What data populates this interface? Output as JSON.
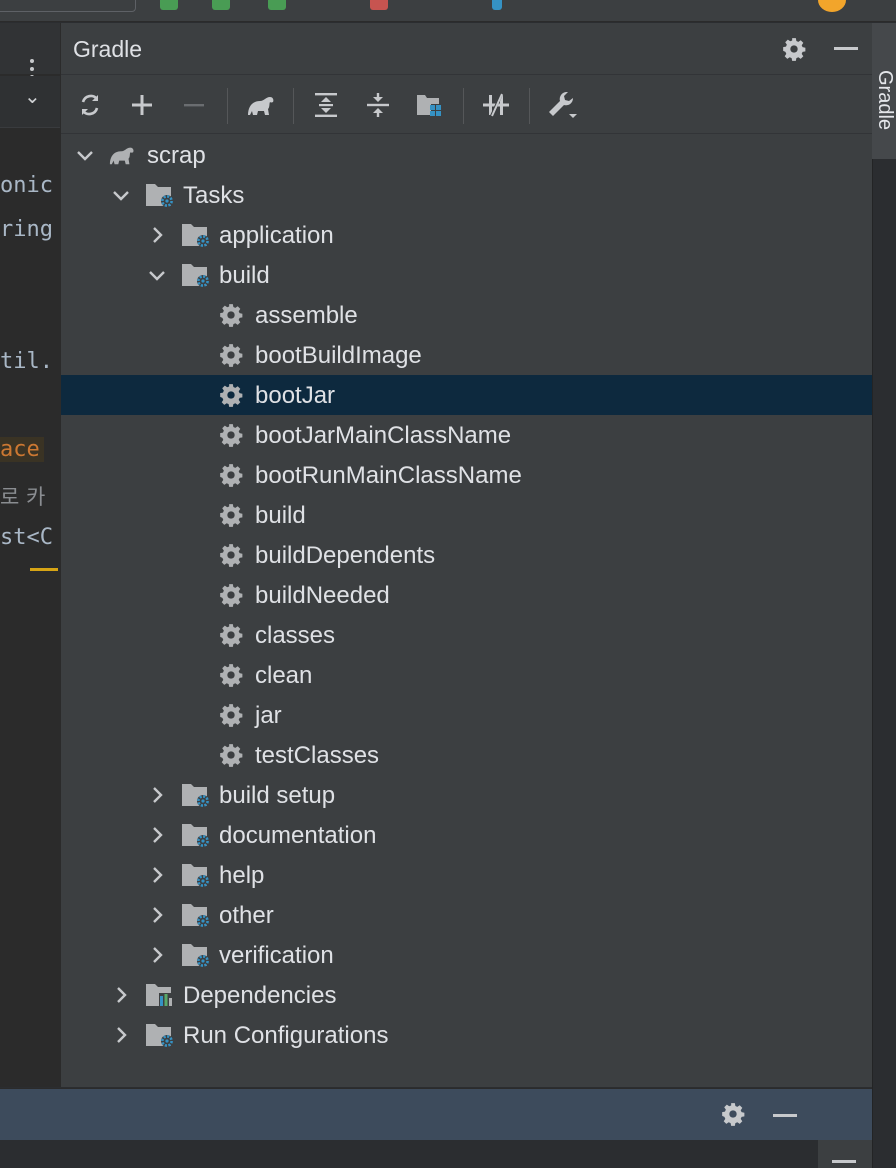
{
  "window": {
    "panel_title": "Gradle",
    "right_tab_label": "Gradle"
  },
  "editor": {
    "lines": [
      {
        "text": "onic"
      },
      {
        "text": "ring"
      },
      {
        "text": "til."
      },
      {
        "text": "ace"
      },
      {
        "text": "로 카"
      },
      {
        "text": "st<C"
      }
    ],
    "tab_chevron": "⌄"
  },
  "toolbar": {
    "buttons": [
      "reload-all-projects",
      "add-project",
      "remove-project",
      "execute-gradle-task",
      "expand-all",
      "collapse-all",
      "group-modules",
      "toggle-offline-mode",
      "build-tool-settings"
    ]
  },
  "tree": {
    "root": "scrap",
    "tasks": "Tasks",
    "groups": {
      "application": "application",
      "build": "build",
      "build_setup": "build setup",
      "documentation": "documentation",
      "help": "help",
      "other": "other",
      "verification": "verification"
    },
    "build_tasks": [
      "assemble",
      "bootBuildImage",
      "bootJar",
      "bootJarMainClassName",
      "bootRunMainClassName",
      "build",
      "buildDependents",
      "buildNeeded",
      "classes",
      "clean",
      "jar",
      "testClasses"
    ],
    "selected": "bootJar",
    "dependencies": "Dependencies",
    "run_configurations": "Run Configurations"
  },
  "colors": {
    "panel_bg": "#3c3f41",
    "selection": "#0d293e",
    "icon_blue": "#3592c4",
    "icon_gray": "#afb1b3"
  }
}
